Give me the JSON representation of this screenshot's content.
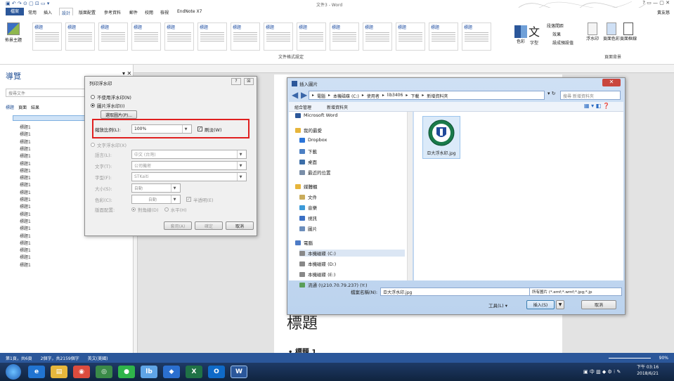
{
  "window": {
    "title": "文件3 - Word",
    "user": "黃友慈"
  },
  "ribbon": {
    "tabs": [
      "檔案",
      "常用",
      "插入",
      "設計",
      "版面配置",
      "參考資料",
      "郵件",
      "校閱",
      "檢視",
      "EndNote X7"
    ],
    "gallery_label": "文件格式設定",
    "background_group": "頁面背景",
    "buttons": {
      "theme": "佈景主題",
      "colors": "色彩",
      "fonts": "字型",
      "paragraph_spacing": "段落間距",
      "effects": "效果",
      "set_default": "設成預設值",
      "watermark": "浮水印",
      "page_color": "頁面色彩",
      "page_border": "頁面框線"
    },
    "styles": [
      "標題",
      "標題",
      "標題",
      "標題",
      "標題",
      "標題",
      "標題",
      "標題",
      "標題",
      "標題",
      "標題",
      "標題",
      "標題",
      "標題"
    ]
  },
  "nav": {
    "title": "導覽",
    "search_placeholder": "搜尋文件",
    "tabs": [
      "標題",
      "頁面",
      "結果"
    ],
    "headings": [
      "標題1",
      "標題1",
      "標題1",
      "標題1",
      "標題1",
      "標題1",
      "標題1",
      "標題1",
      "標題1",
      "標題1",
      "標題1",
      "標題1",
      "標題1",
      "標題1",
      "標題1",
      "標題1",
      "標題1",
      "標題1",
      "標題1",
      "標題1"
    ]
  },
  "watermark_dialog": {
    "title": "列印浮水印",
    "help": "?",
    "close": "☒",
    "no_watermark": "不使用浮水印(N)",
    "picture_watermark": "圖片浮水印(I)",
    "select_picture": "選取圖片(P)...",
    "scale_label": "縮放比例(L):",
    "scale_value": "100%",
    "washout": "刷淡(W)",
    "text_watermark": "文字浮水印(X)",
    "language_label": "語言(L):",
    "language_value": "中文 (台灣)",
    "text_label": "文字(T):",
    "text_value": "公司機密",
    "font_label": "字型(F):",
    "font_value": "STKaiti",
    "size_label": "大小(S):",
    "size_value": "自動",
    "color_label": "色彩(C):",
    "color_value": "自動",
    "semitransparent": "半透明(E)",
    "layout_label": "版面配置:",
    "diagonal": "對角線(D)",
    "horizontal": "水平(H)",
    "apply": "套用(A)",
    "ok": "確定",
    "cancel": "取消"
  },
  "insert_dialog": {
    "title": "插入圖片",
    "path": [
      "電腦",
      "本機磁碟 (C:)",
      "使用者",
      "lib3406",
      "下載",
      "新增資料夾"
    ],
    "search_placeholder": "搜尋 新增資料夾",
    "organize": "組合管理",
    "new_folder": "新增資料夾",
    "tree": [
      "Microsoft Word",
      "我的最愛",
      "Dropbox",
      "下載",
      "桌面",
      "最近的位置",
      "媒體櫃",
      "文件",
      "音樂",
      "視訊",
      "圖片",
      "電腦",
      "本機磁碟 (C:)",
      "本機磁碟 (D:)",
      "本機磁碟 (E:)",
      "流通 (\\\\210.70.79.237) (Y:)"
    ],
    "file_name": "亞大浮水印.jpg",
    "filename_label": "檔案名稱(N):",
    "filename_value": "亞大浮水印.jpg",
    "filter_value": "所有圖片 (*.emf;*.wmf;*.jpg;*.jp",
    "tools": "工具(L)",
    "insert": "插入(S)",
    "cancel": "取消"
  },
  "document": {
    "title": "標題",
    "heading1": "標題 1"
  },
  "status": {
    "page": "第1頁，共6頁",
    "words": "2個字，共2159個字",
    "lang": "英文(美國)",
    "zoom": "90%"
  },
  "taskbar": {
    "time": "下午 03:16",
    "date": "2018/6/21"
  }
}
